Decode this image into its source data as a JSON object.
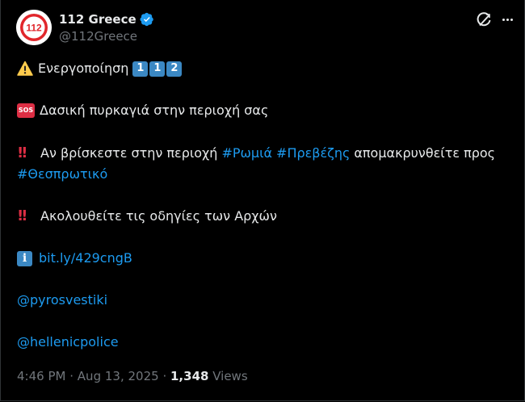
{
  "account": {
    "name": "112 Greece",
    "handle": "@112Greece",
    "avatar_text": "112"
  },
  "tweet": {
    "line1": {
      "text": "Ενεργοποίηση",
      "keys": [
        "1",
        "1",
        "2"
      ]
    },
    "line2": {
      "badge": "SOS",
      "text": "Δασική πυρκαγιά στην περιοχή σας"
    },
    "line3": {
      "prefix": "Αν βρίσκεστε στην περιοχή",
      "tag1": "#Ρωμιά",
      "tag2": "#Πρεβέζης",
      "suffix": "απομακρυνθείτε προς",
      "tag3": "#Θεσπρωτικό"
    },
    "line4": {
      "text": "Ακολουθείτε τις οδηγίες των Αρχών"
    },
    "line5": {
      "info_glyph": "i",
      "link": "bit.ly/429cngB"
    },
    "mention1": "@pyrosvestiki",
    "mention2": "@hellenicpolice"
  },
  "meta": {
    "time": "4:46 PM",
    "separator": "·",
    "date": "Aug 13, 2025",
    "views_count": "1,348",
    "views_label": "Views"
  },
  "icons": {
    "verified": "verified-badge-icon",
    "grok": "grok-icon",
    "more": "more-icon",
    "warning": "warning-icon",
    "double_exclamation": "double-exclamation-icon",
    "sos": "sos-icon",
    "info": "info-icon"
  },
  "colors": {
    "background": "#000000",
    "text": "#e7e9ea",
    "muted": "#71767b",
    "link": "#1d9bf0",
    "brand_red": "#e1262b"
  }
}
